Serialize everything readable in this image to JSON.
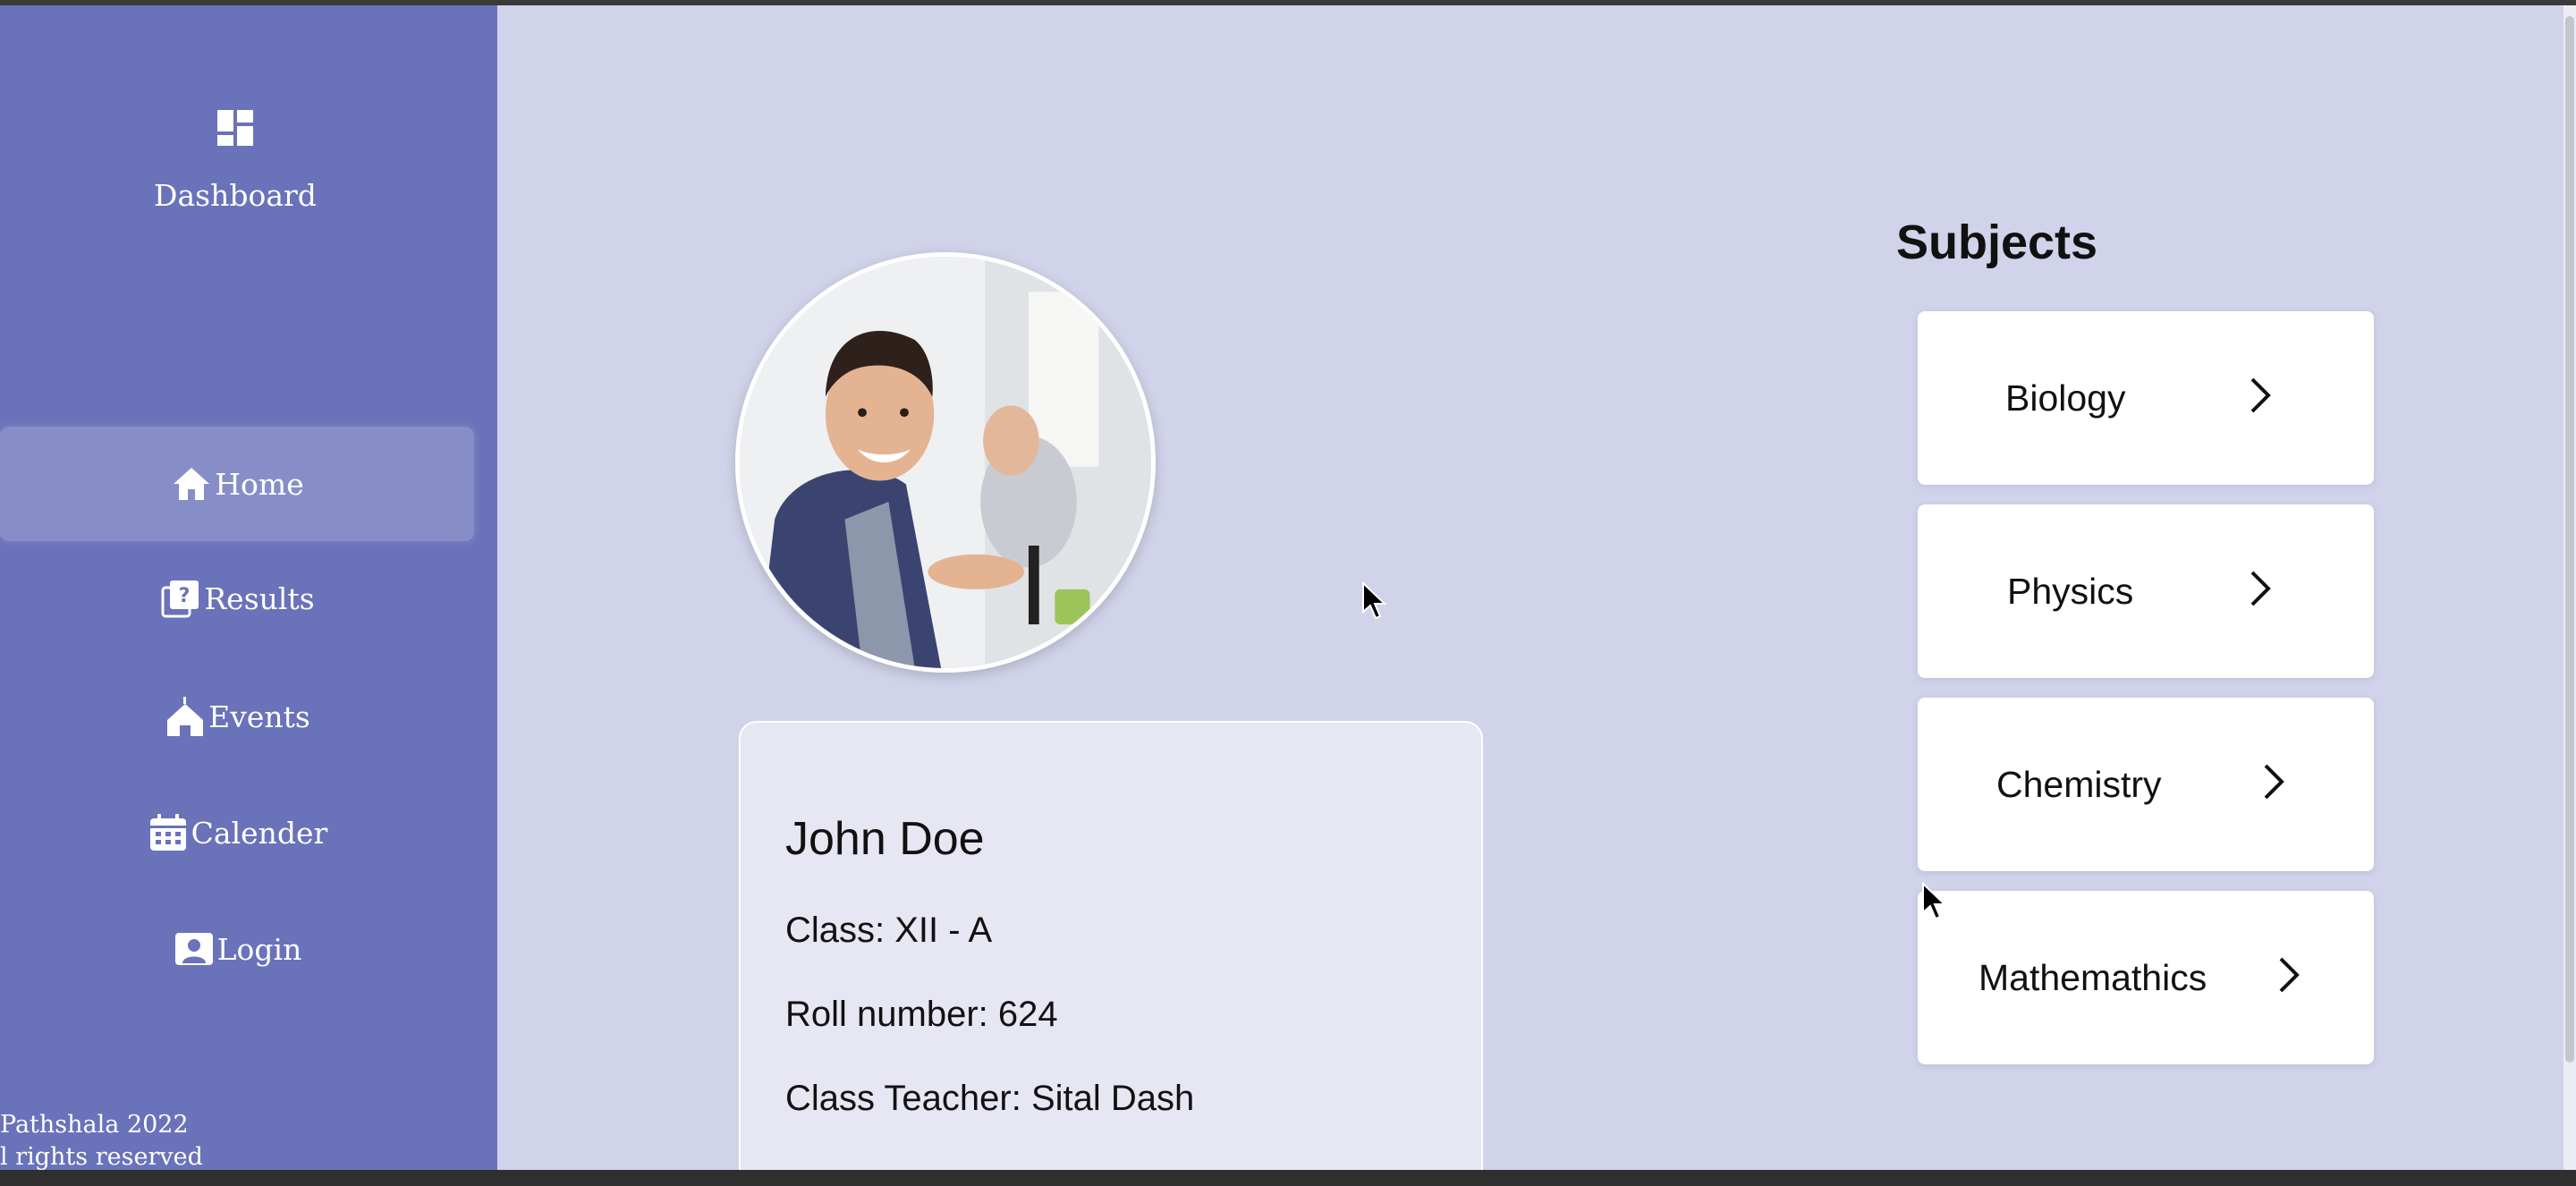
{
  "sidebar": {
    "dashboard": {
      "label": "Dashboard",
      "icon": "dashboard-icon"
    },
    "items": [
      {
        "label": "Home",
        "icon": "home-icon",
        "active": true
      },
      {
        "label": "Results",
        "icon": "results-icon"
      },
      {
        "label": "Events",
        "icon": "events-icon"
      },
      {
        "label": "Calender",
        "icon": "calendar-icon"
      },
      {
        "label": "Login",
        "icon": "login-icon"
      }
    ],
    "footer": {
      "line1": "Pathshala 2022",
      "line2": "l rights reserved"
    }
  },
  "student": {
    "name": "John Doe",
    "class": "Class: XII - A",
    "roll": "Roll number: 624",
    "teacher": "Class Teacher: Sital Dash"
  },
  "subjects": {
    "title": "Subjects",
    "items": [
      {
        "label": "Biology"
      },
      {
        "label": "Physics"
      },
      {
        "label": "Chemistry"
      },
      {
        "label": "Mathemathics"
      }
    ]
  },
  "colors": {
    "sidebar": "#6a72ba",
    "main_bg": "#d1d3ea",
    "card_bg": "#ffffff",
    "info_card_bg": "#e6e7f3"
  }
}
